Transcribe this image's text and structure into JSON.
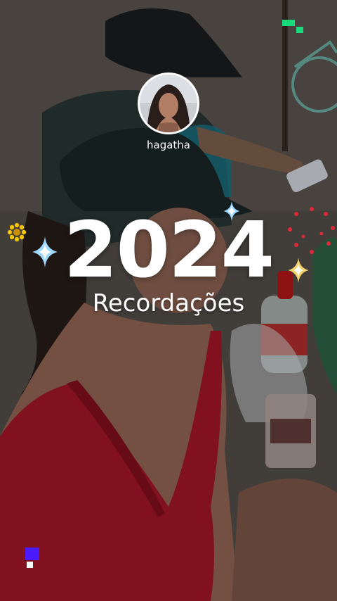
{
  "story": {
    "username": "hagatha",
    "year": "2024",
    "subtitle": "Recordações"
  },
  "colors": {
    "text": "#ffffff",
    "sparkle_blue": "#9fd8ff",
    "sparkle_yellow": "#f5d36b",
    "confetti_red": "#e0283a",
    "flower_yellow": "#f2c300",
    "pixel_green": "#19d97a",
    "pixel_violet": "#4b1bff"
  },
  "decorations": {
    "avatar": "profile-photo",
    "sparkles": [
      "sparkle-icon",
      "sparkle-icon",
      "sparkle-icon"
    ],
    "flower": "flower-icon",
    "confetti": "confetti-ring-icon",
    "pixels": [
      "green-pixel-blocks",
      "violet-pixel-blocks"
    ]
  }
}
